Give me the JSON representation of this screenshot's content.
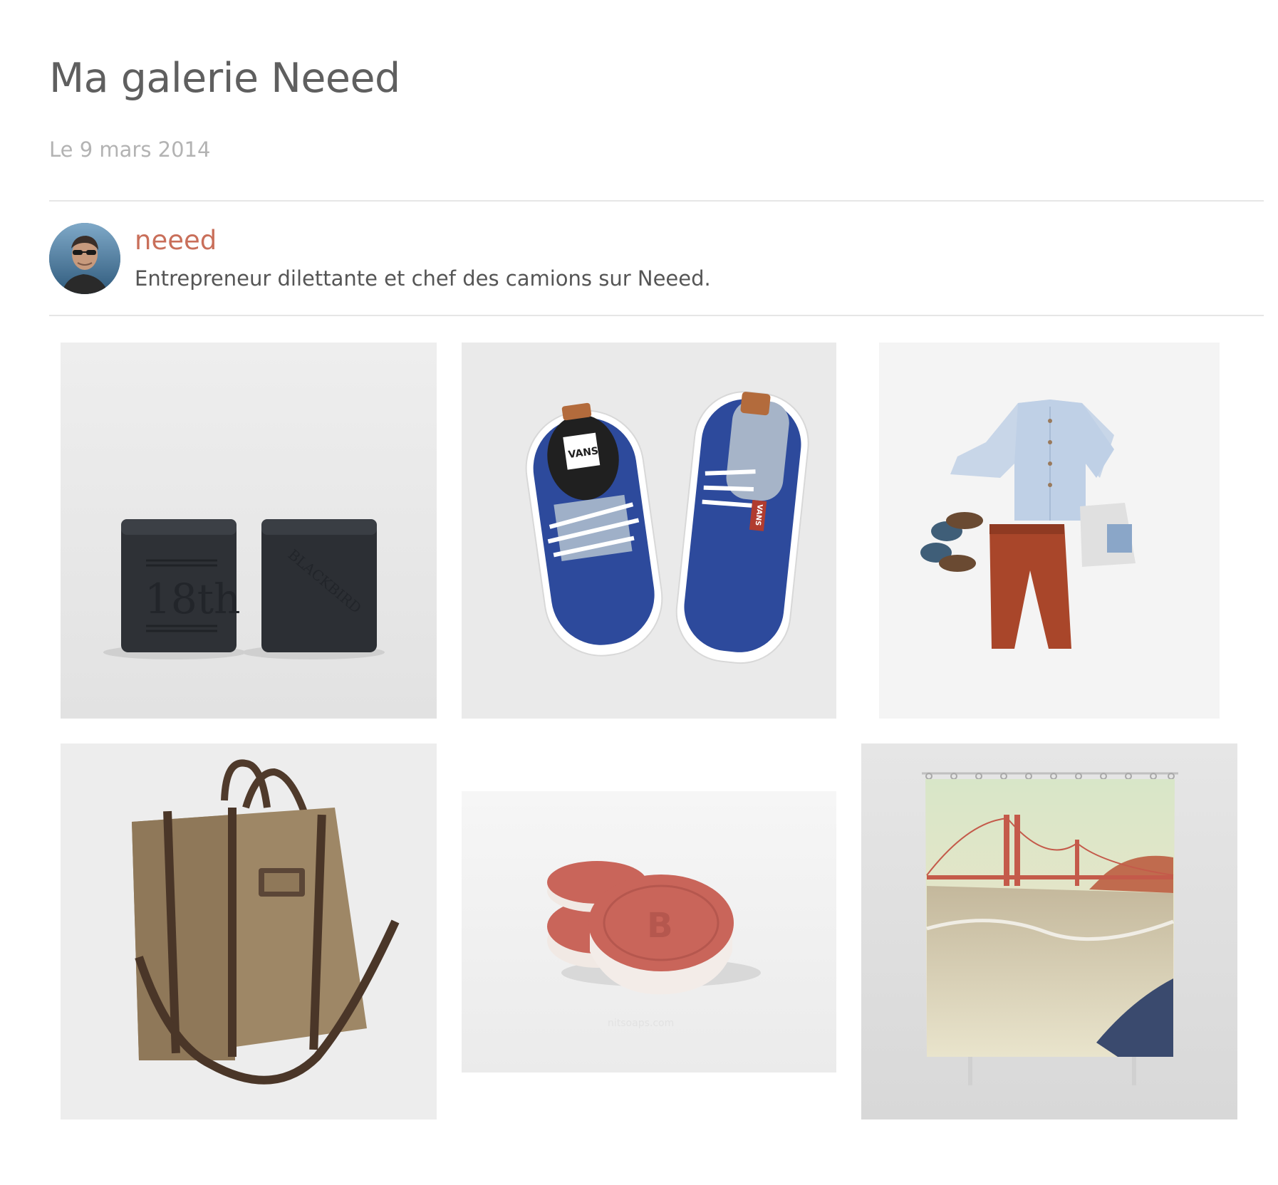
{
  "post": {
    "title": "Ma galerie Neeed",
    "date": "Le 9 mars 2014"
  },
  "author": {
    "name": "neeed",
    "bio": "Entrepreneur dilettante et chef des camions sur Neeed.",
    "name_color": "#c96f5a"
  },
  "gallery": [
    {
      "subject": "black soap cubes",
      "stamp_text": "18th",
      "side_text": "BLACKBIRD"
    },
    {
      "subject": "blue vans sneakers",
      "tongue_text": "VANS",
      "heel_text": "VANS"
    },
    {
      "subject": "children's outfit"
    },
    {
      "subject": "canvas tote backpack"
    },
    {
      "subject": "bitcoin soaps",
      "coin_text": "B",
      "watermark_text": "nitsoaps.com"
    },
    {
      "subject": "golden gate shower curtain"
    }
  ],
  "colors": {
    "title": "#5f5f5f",
    "date": "#b3b3b3",
    "bio": "#555555",
    "divider": "#e6e6e6"
  }
}
